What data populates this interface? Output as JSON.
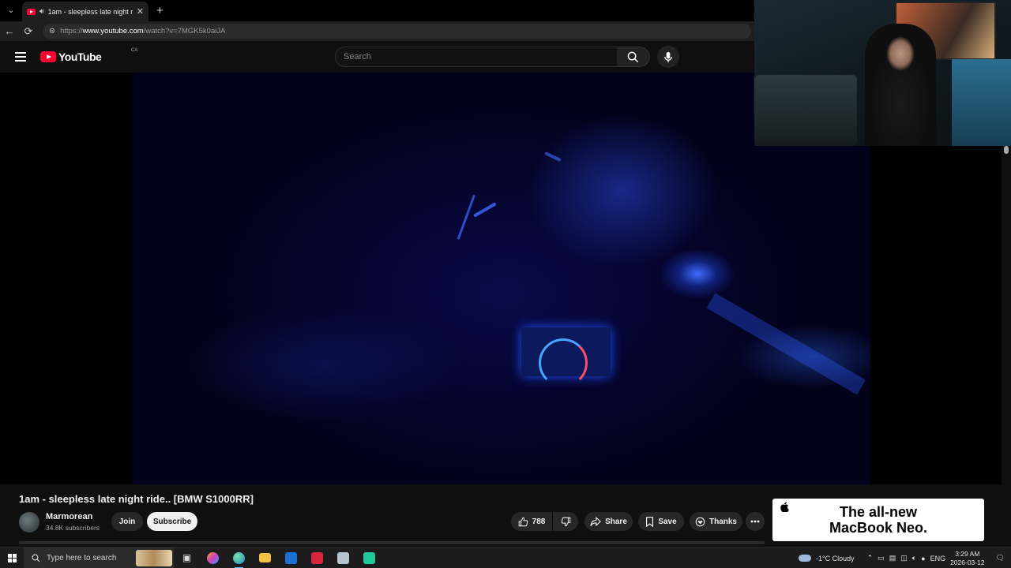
{
  "browser": {
    "tab_title": "1am - sleepless late night ride.. [BMW S1000RR] - YouTube",
    "tab_title_display": "1am - sleepless late night ride",
    "url": "https://www.youtube.com/watch?v=7MGK5k0aiJA",
    "url_prefix": "https://",
    "url_host": "www.youtube.com",
    "url_path": "/watch?v=7MGK5k0aiJA"
  },
  "masthead": {
    "logo_text": "YouTube",
    "country_code": "CA",
    "search_placeholder": "Search"
  },
  "video": {
    "title": "1am - sleepless late night ride.. [BMW S1000RR]",
    "channel_name": "Marmorean",
    "subscribers": "34.8K subscribers",
    "join_label": "Join",
    "subscribe_label": "Subscribe",
    "like_count": "788",
    "share_label": "Share",
    "save_label": "Save",
    "thanks_label": "Thanks"
  },
  "ad": {
    "line1": "The all-new",
    "line2": "MacBook Neo."
  },
  "taskbar": {
    "search_placeholder": "Type here to search",
    "weather": "-1°C  Cloudy",
    "language": "ENG",
    "time": "3:29 AM",
    "date": "2026-03-12"
  },
  "colors": {
    "youtube_red": "#ff0033",
    "background": "#0f0f0f",
    "pill": "#272727",
    "accent_blue": "#4cc2ff"
  }
}
